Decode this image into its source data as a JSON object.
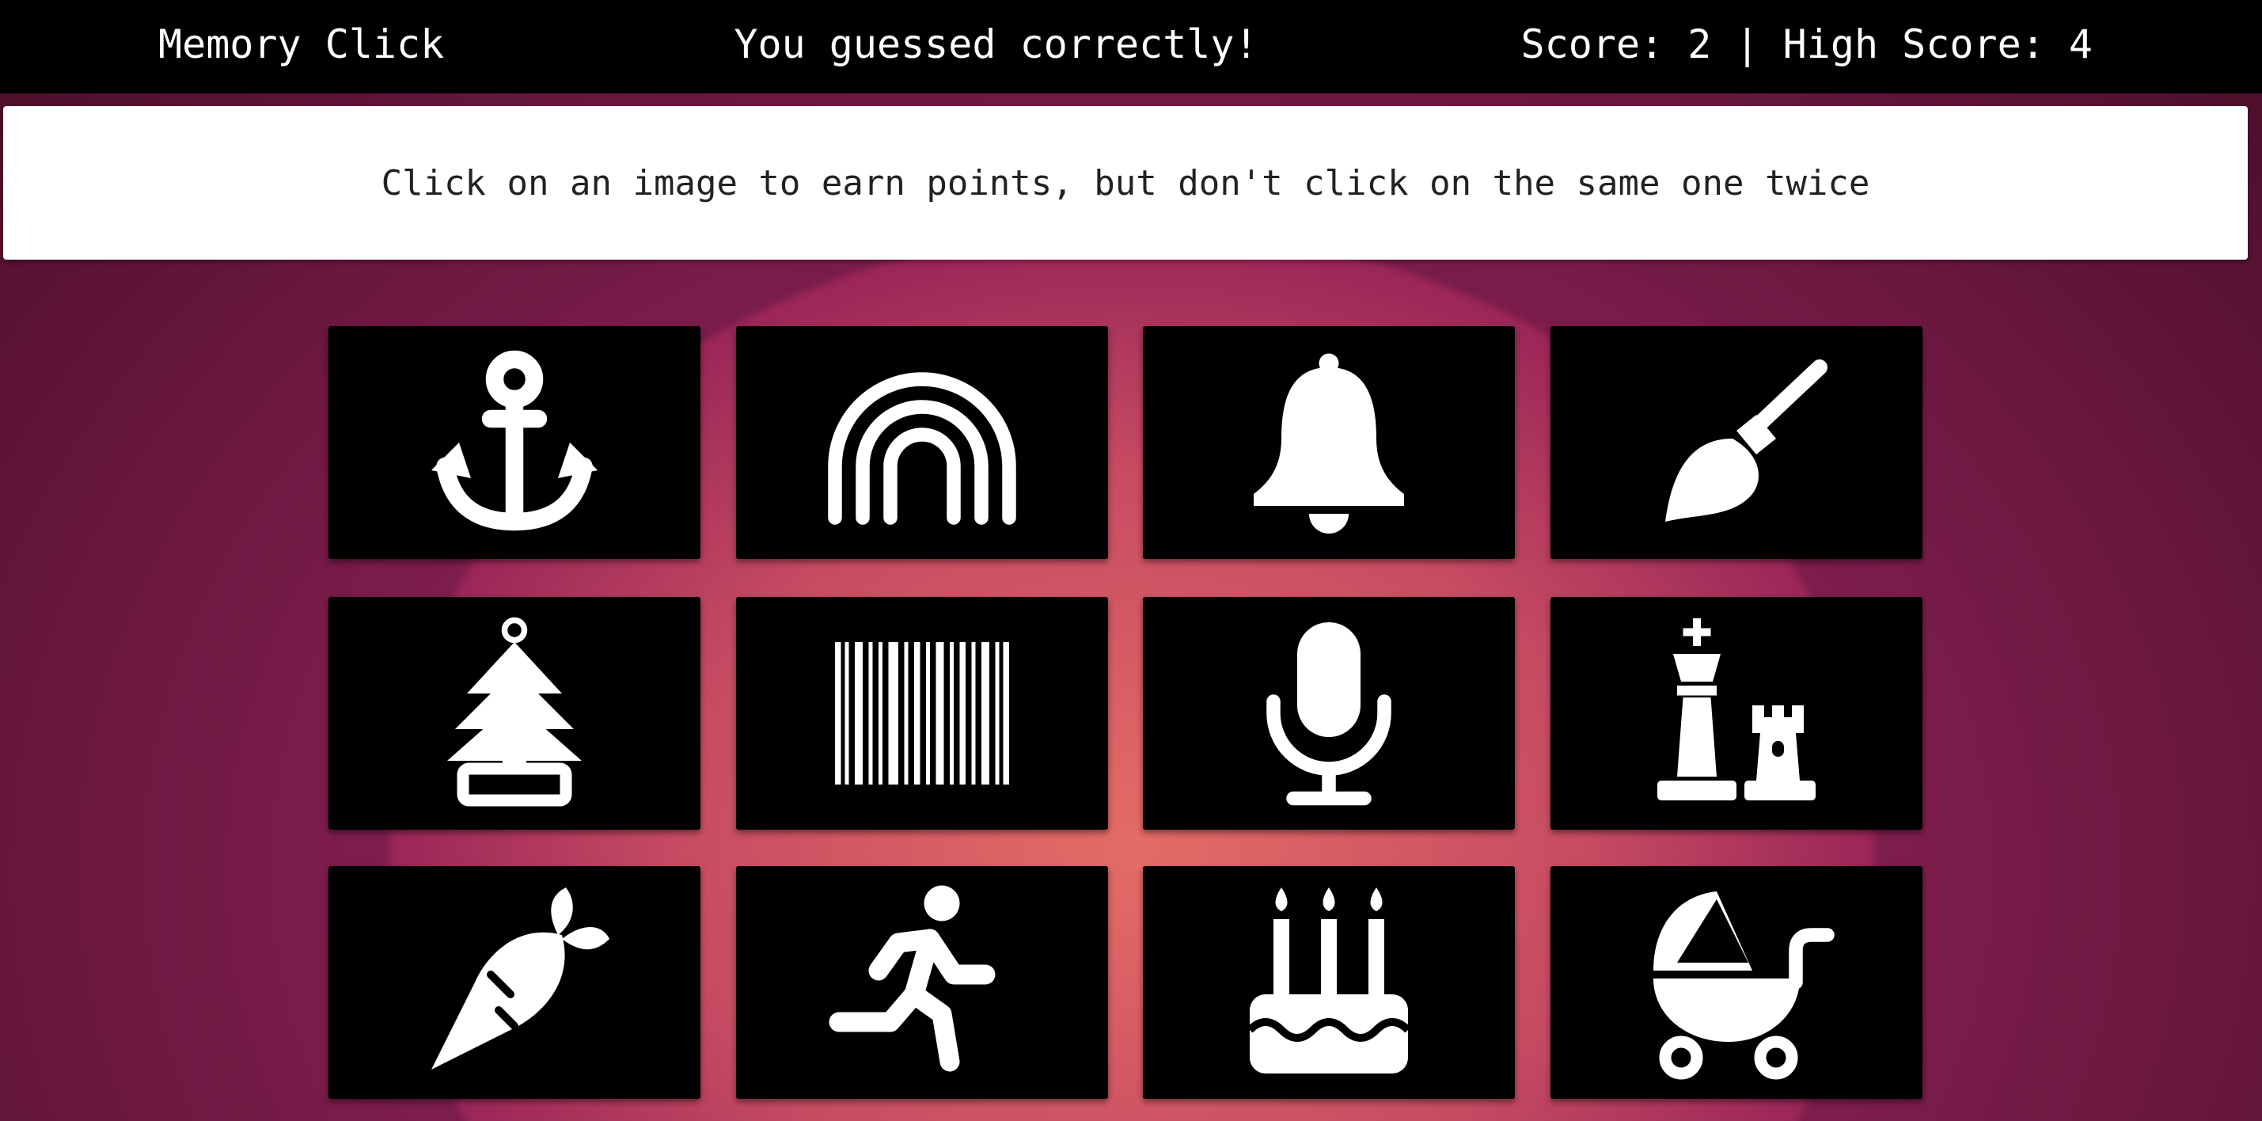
{
  "header": {
    "brand": "Memory Click",
    "status": "You guessed correctly!",
    "score_text": "Score: 2 | High Score: 4"
  },
  "instructions": "Click on an image to earn points, but don't click on the same one twice",
  "cards": [
    {
      "icon": "anchor-icon"
    },
    {
      "icon": "rainbow-icon"
    },
    {
      "icon": "bell-icon"
    },
    {
      "icon": "brush-icon"
    },
    {
      "icon": "tree-icon"
    },
    {
      "icon": "barcode-icon"
    },
    {
      "icon": "microphone-icon"
    },
    {
      "icon": "chess-icon"
    },
    {
      "icon": "carrot-icon"
    },
    {
      "icon": "running-person-icon"
    },
    {
      "icon": "birthday-cake-icon"
    },
    {
      "icon": "baby-carriage-icon"
    }
  ],
  "colors": {
    "card": "#000000",
    "icon": "#ffffff",
    "banner": "#ffffff"
  }
}
